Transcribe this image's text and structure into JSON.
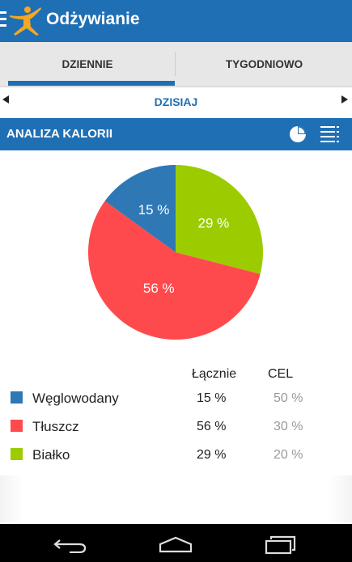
{
  "app": {
    "title": "Odżywianie"
  },
  "tabs": [
    {
      "label": "DZIENNIE",
      "active": true
    },
    {
      "label": "TYGODNIOWO",
      "active": false
    }
  ],
  "date": {
    "label": "DZISIAJ"
  },
  "section": {
    "title": "ANALIZA KALORII"
  },
  "colors": {
    "accent": "#1f6fb5",
    "carbs": "#2e78b5",
    "fat": "#ff4a4d",
    "protein": "#9ccc00"
  },
  "icons": [
    "menu-icon",
    "logo-icon",
    "pie-view-icon",
    "list-view-icon",
    "back-nav-icon",
    "home-nav-icon",
    "recents-nav-icon"
  ],
  "table": {
    "headers": {
      "total": "Łącznie",
      "goal": "CEL"
    },
    "rows": [
      {
        "name": "Węglowodany",
        "total": "15 %",
        "goal": "50 %"
      },
      {
        "name": "Tłuszcz",
        "total": "56 %",
        "goal": "30 %"
      },
      {
        "name": "Białko",
        "total": "29 %",
        "goal": "20 %"
      }
    ]
  },
  "chart_data": {
    "type": "pie",
    "categories": [
      "Węglowodany",
      "Tłuszcz",
      "Białko"
    ],
    "values": [
      15,
      56,
      29
    ],
    "labels": [
      "15 %",
      "56 %",
      "29 %"
    ]
  }
}
